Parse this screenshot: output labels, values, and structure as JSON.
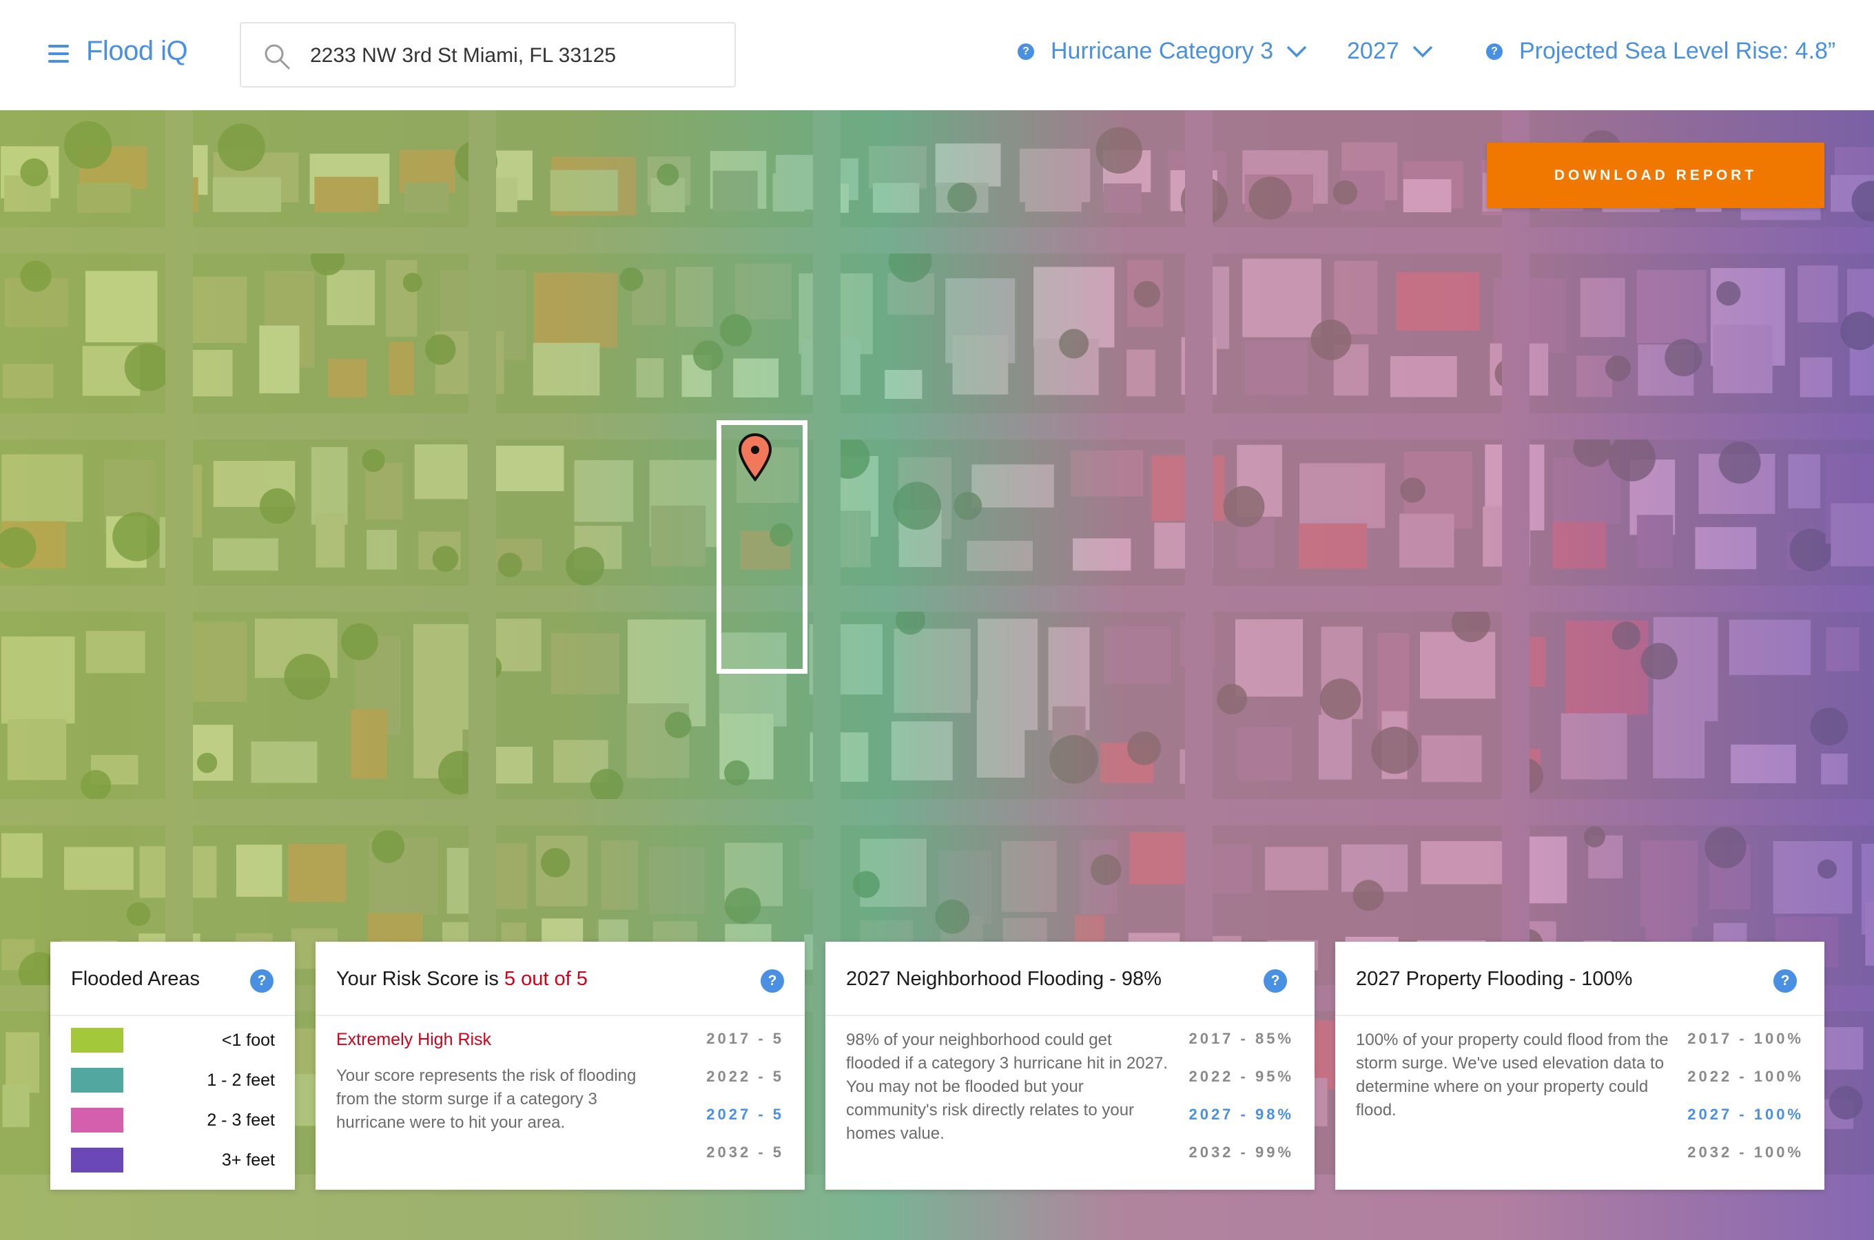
{
  "header": {
    "logo": "Flood iQ",
    "search_value": "2233 NW 3rd St Miami, FL 33125",
    "hurricane_label": "Hurricane Category 3",
    "year_label": "2027",
    "sea_level_label": "Projected Sea Level Rise: 4.8”"
  },
  "map": {
    "download_label": "DOWNLOAD REPORT",
    "zoom_in": "+",
    "zoom_out": "−"
  },
  "legend": {
    "title": "Flooded Areas",
    "help": "?",
    "items": [
      {
        "label": "<1 foot",
        "color": "#a3c93a"
      },
      {
        "label": "1 - 2 feet",
        "color": "#52a8a0"
      },
      {
        "label": "2 - 3 feet",
        "color": "#d35fad"
      },
      {
        "label": "3+ feet",
        "color": "#6a48b5"
      }
    ]
  },
  "risk_card": {
    "title_prefix": "Your Risk Score is ",
    "title_score": "5 out of 5",
    "help": "?",
    "level": "Extremely High Risk",
    "description": "Your score represents the risk of flooding from the storm surge if a category 3 hurricane were to hit your area.",
    "years": [
      "2017 - 5",
      "2022 - 5",
      "2027 - 5",
      "2032 - 5"
    ],
    "active_index": 2
  },
  "neighborhood_card": {
    "title": "2027 Neighborhood Flooding - 98%",
    "help": "?",
    "description": "98% of your neighborhood could get flooded if a category 3 hurricane hit in 2027. You may not be flooded but your community's risk directly relates to your homes value.",
    "years": [
      "2017 - 85%",
      "2022 - 95%",
      "2027 - 98%",
      "2032 - 99%"
    ],
    "active_index": 2
  },
  "property_card": {
    "title": "2027 Property Flooding - 100%",
    "help": "?",
    "description": "100% of your property could flood from the storm surge. We've used elevation data to determine where on your property could flood.",
    "years": [
      "2017 - 100%",
      "2022 - 100%",
      "2027 - 100%",
      "2032 - 100%"
    ],
    "active_index": 2
  },
  "colors": {
    "accent": "#4a90e2",
    "download": "#f07700",
    "risk": "#d0021b"
  }
}
